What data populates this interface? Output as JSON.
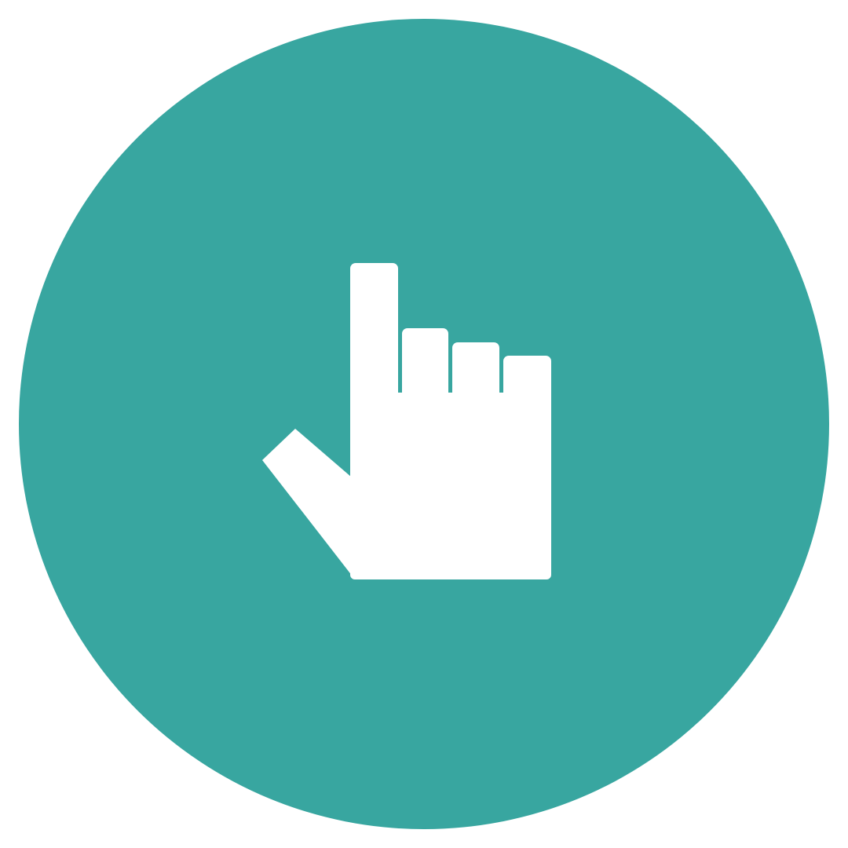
{
  "icon": {
    "name": "pointing-hand-icon",
    "background_color": "#38a6a0",
    "foreground_color": "#ffffff"
  }
}
